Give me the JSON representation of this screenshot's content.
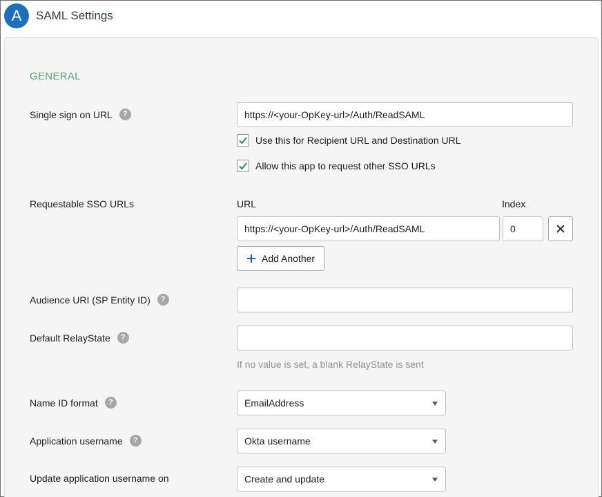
{
  "header": {
    "step_letter": "A",
    "title": "SAML Settings"
  },
  "general": {
    "section_title": "GENERAL",
    "help_glyph": "?",
    "sso_url": {
      "label": "Single sign on URL",
      "value": "https://<your-OpKey-url>/Auth/ReadSAML",
      "checkbox_recipient": {
        "label": "Use this for Recipient URL and Destination URL",
        "checked": true
      },
      "checkbox_allow_other": {
        "label": "Allow this app to request other SSO URLs",
        "checked": true
      }
    },
    "requestable": {
      "label": "Requestable SSO URLs",
      "col_url": "URL",
      "col_index": "Index",
      "rows": [
        {
          "url": "https://<your-OpKey-url>/Auth/ReadSAML",
          "index": "0"
        }
      ],
      "add_label": "Add Another"
    },
    "audience": {
      "label": "Audience URI (SP Entity ID)",
      "value": ""
    },
    "relay": {
      "label": "Default RelayState",
      "value": "",
      "hint": "If no value is set, a blank RelayState is sent"
    },
    "name_id": {
      "label": "Name ID format",
      "selected": "EmailAddress"
    },
    "app_username": {
      "label": "Application username",
      "selected": "Okta username"
    },
    "update_on": {
      "label": "Update application username on",
      "selected": "Create and update"
    }
  },
  "colors": {
    "accent_green": "#4aa87e",
    "step_blue": "#1a6fbf",
    "check_green": "#2e8b57"
  }
}
